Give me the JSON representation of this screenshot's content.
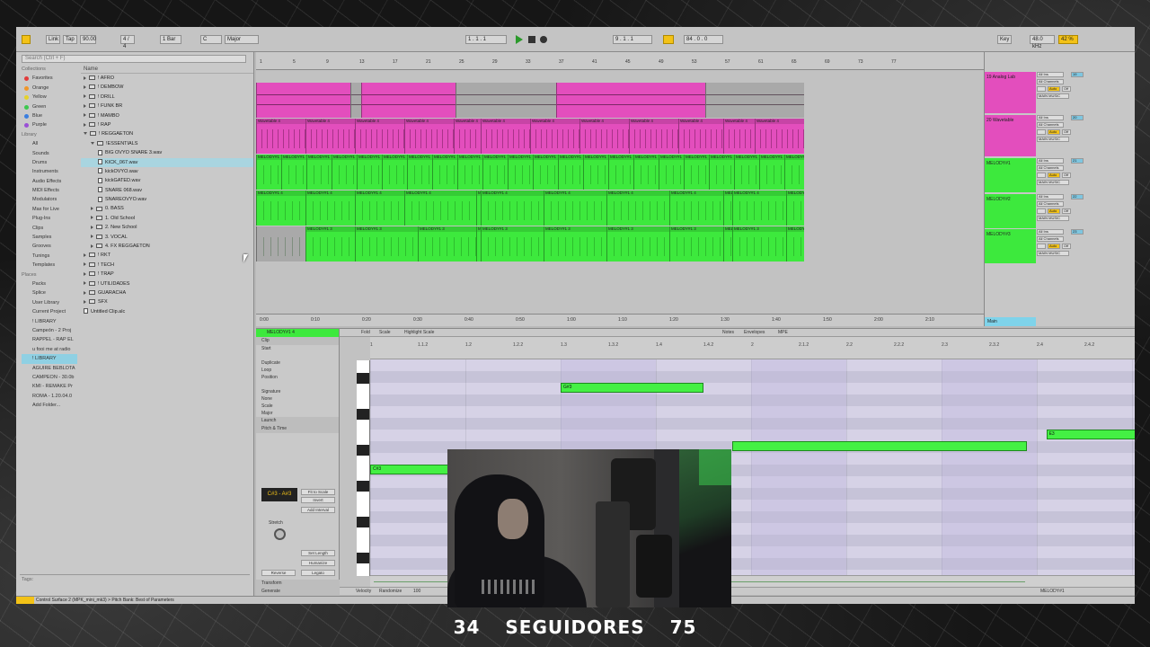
{
  "topbar": {
    "link": "Link",
    "tap": "Tap",
    "tempo": "90.00",
    "signature": "4 / 4",
    "quantize": "1 Bar",
    "key": "C",
    "scale": "Major",
    "position": "1 . 1 . 1",
    "loop_start": "9 . 1 . 1",
    "loop_len": "84 . 0 . 0",
    "key_label": "Key",
    "sample_rate": "48.0 kHz",
    "cpu": "42 %"
  },
  "browser": {
    "search_placeholder": "Search (Ctrl + F)",
    "collections_head": "Collections",
    "collections": [
      {
        "label": "Favorites",
        "color": "#e23b3b"
      },
      {
        "label": "Orange",
        "color": "#f0962a"
      },
      {
        "label": "Yellow",
        "color": "#e5d22a"
      },
      {
        "label": "Green",
        "color": "#3cc84f"
      },
      {
        "label": "Blue",
        "color": "#3a7ee0"
      },
      {
        "label": "Purple",
        "color": "#9a4fd6"
      }
    ],
    "library_head": "Library",
    "library": [
      "All",
      "Sounds",
      "Drums",
      "Instruments",
      "Audio Effects",
      "MIDI Effects",
      "Modulators",
      "Max for Live",
      "Plug-Ins",
      "Clips",
      "Samples",
      "Grooves",
      "Tunings",
      "Templates"
    ],
    "places_head": "Places",
    "places": [
      "Packs",
      "Splice",
      "User Library",
      "Current Project",
      "! LIBRARY",
      "Campeón - 2 Proj",
      "RAPPEL - RAP EL",
      "u fooi me at radio",
      "! LIBRARY",
      "AGUIRE BEBLOTA",
      "CAMPEON - 30.0b",
      "KMI - REMAKE Pr",
      "ROMA - 1.20.04.0",
      "Add Folder..."
    ],
    "selected_place_index": 8,
    "name_head": "Name",
    "tree": [
      {
        "label": "! AFRO",
        "depth": 0,
        "kind": "folder",
        "open": false
      },
      {
        "label": "! DEMBOW",
        "depth": 0,
        "kind": "folder",
        "open": false
      },
      {
        "label": "! DRILL",
        "depth": 0,
        "kind": "folder",
        "open": false
      },
      {
        "label": "! FUNK BR",
        "depth": 0,
        "kind": "folder",
        "open": false
      },
      {
        "label": "! MAMBO",
        "depth": 0,
        "kind": "folder",
        "open": false
      },
      {
        "label": "! RAP",
        "depth": 0,
        "kind": "folder",
        "open": false
      },
      {
        "label": "! REGGAETON",
        "depth": 0,
        "kind": "folder",
        "open": true
      },
      {
        "label": "!ESSENTIALS",
        "depth": 1,
        "kind": "folder",
        "open": true
      },
      {
        "label": "BIG OVYO SNARE 3.wav",
        "depth": 2,
        "kind": "file"
      },
      {
        "label": "KICK_067.wav",
        "depth": 2,
        "kind": "file",
        "selected": true
      },
      {
        "label": "kickOVYO.wav",
        "depth": 2,
        "kind": "file"
      },
      {
        "label": "kickGATED.wav",
        "depth": 2,
        "kind": "file"
      },
      {
        "label": "SNARE 068.wav",
        "depth": 2,
        "kind": "file"
      },
      {
        "label": "SNAREOVYO.wav",
        "depth": 2,
        "kind": "file"
      },
      {
        "label": "0. BASS",
        "depth": 1,
        "kind": "folder",
        "open": false
      },
      {
        "label": "1. Old School",
        "depth": 1,
        "kind": "folder",
        "open": false
      },
      {
        "label": "2. New School",
        "depth": 1,
        "kind": "folder",
        "open": false
      },
      {
        "label": "3. VOCAL",
        "depth": 1,
        "kind": "folder",
        "open": false
      },
      {
        "label": "4. FX REGGAETON",
        "depth": 1,
        "kind": "folder",
        "open": false
      },
      {
        "label": "! RKT",
        "depth": 0,
        "kind": "folder",
        "open": false
      },
      {
        "label": "! TECH",
        "depth": 0,
        "kind": "folder",
        "open": false
      },
      {
        "label": "! TRAP",
        "depth": 0,
        "kind": "folder",
        "open": false
      },
      {
        "label": "! UTILIDADES",
        "depth": 0,
        "kind": "folder",
        "open": false
      },
      {
        "label": "GUARACHA",
        "depth": 0,
        "kind": "folder",
        "open": false
      },
      {
        "label": "SFX",
        "depth": 0,
        "kind": "folder",
        "open": false
      },
      {
        "label": "Untitled Clip.alc",
        "depth": 0,
        "kind": "file"
      }
    ],
    "tags_label": "Tags:"
  },
  "arrangement": {
    "ruler_marks": [
      "1",
      "5",
      "9",
      "13",
      "17",
      "21",
      "25",
      "29",
      "33",
      "37",
      "41",
      "45",
      "49",
      "53",
      "57",
      "61",
      "65",
      "69",
      "73",
      "77"
    ],
    "time_marks": [
      "0:00",
      "0:10",
      "0:20",
      "0:30",
      "0:40",
      "0:50",
      "1:00",
      "1:10",
      "1:20",
      "1:30",
      "1:40",
      "1:50",
      "2:00",
      "2:10"
    ],
    "tracks": [
      {
        "name": "Bass",
        "color": "#e34ebd",
        "clip_label": "",
        "kind": "midi"
      },
      {
        "name": "Wavetable",
        "color": "#e34ebd",
        "clip_label": "Wavetable 4",
        "kind": "wave"
      },
      {
        "name": "MELODY#1",
        "color": "#3de93d",
        "clip_label": "MELODY#1",
        "kind": "wave"
      },
      {
        "name": "MELODY#2",
        "color": "#3de93d",
        "clip_label": "MELODY#1 4",
        "kind": "wave"
      },
      {
        "name": "MELODY#3",
        "color": "#3de93d",
        "clip_label": "MELODY#1 3",
        "kind": "wave"
      }
    ]
  },
  "mixer": {
    "tracks": [
      {
        "name": "19 Analog Lab",
        "num": "19",
        "color": "#e34ebd"
      },
      {
        "name": "20 Wavetable",
        "num": "20",
        "color": "#e34ebd"
      },
      {
        "name": "MELODY#1",
        "num": "21",
        "color": "#3de93d"
      },
      {
        "name": "MELODY#2",
        "num": "22",
        "color": "#3de93d"
      },
      {
        "name": "MELODY#3",
        "num": "23",
        "color": "#3de93d"
      }
    ],
    "input": "All Ins",
    "channel": "All Channels",
    "auto": "Auto",
    "off": "Off",
    "output": "MAIN MUSIC",
    "main": "Main",
    "main_out": "1/2"
  },
  "clipview": {
    "clip_name": "MELODY#1 4",
    "fold": "Fold",
    "scale": "Scale",
    "highlight_scale": "Highlight Scale",
    "tabs": [
      "Notes",
      "Envelopes",
      "MPE"
    ],
    "clip_section": "Clip",
    "start": "Start",
    "end": "End",
    "duplicate": "Duplicate",
    "loop": "Loop",
    "position": "Position",
    "length": "Length",
    "signature": "Signature",
    "groove": "Groove",
    "sig_num": "4",
    "sig_den": "4",
    "groove_val": "None",
    "scale_label": "Scale",
    "scale_key": "C",
    "scale_mode": "Major",
    "launch": "Launch",
    "pitch_time": "Pitch & Time",
    "range": "C#3 - A#3",
    "fit_to_scale": "Fit to Scale",
    "invert": "Invert",
    "add_interval": "Add Interval",
    "stretch": "Stretch",
    "set_length": "Set Length",
    "humanize": "Humanize",
    "reverse": "Reverse",
    "legato": "Legato",
    "transform": "Transform",
    "generate": "Generate",
    "velocity": "Velocity",
    "randomize": "Randomize",
    "vel_val": "100",
    "ruler_marks": [
      "1",
      "1.1.2",
      "1.2",
      "1.2.2",
      "1.3",
      "1.3.2",
      "1.4",
      "1.4.2",
      "2",
      "2.1.2",
      "2.2",
      "2.2.2",
      "2.3",
      "2.3.2",
      "2.4",
      "2.4.2"
    ],
    "notes": [
      {
        "label": "C#3",
        "start": 0.0,
        "length": 1.0,
        "row": 9
      },
      {
        "label": "G#3",
        "start": 2.0,
        "length": 1.5,
        "row": 2
      },
      {
        "label": "",
        "start": 3.8,
        "length": 3.1,
        "row": 7
      },
      {
        "label": "E3",
        "start": 7.1,
        "length": 1.0,
        "row": 6
      }
    ],
    "vel_top": "127",
    "status_tail": "MELODY#1"
  },
  "status_message": "Control Surface 2 (MPK_mini_mk3) > Pitch Bank: Best of Parameters",
  "caption": {
    "left": "34",
    "middle": "SEGUIDORES",
    "right": "75"
  }
}
